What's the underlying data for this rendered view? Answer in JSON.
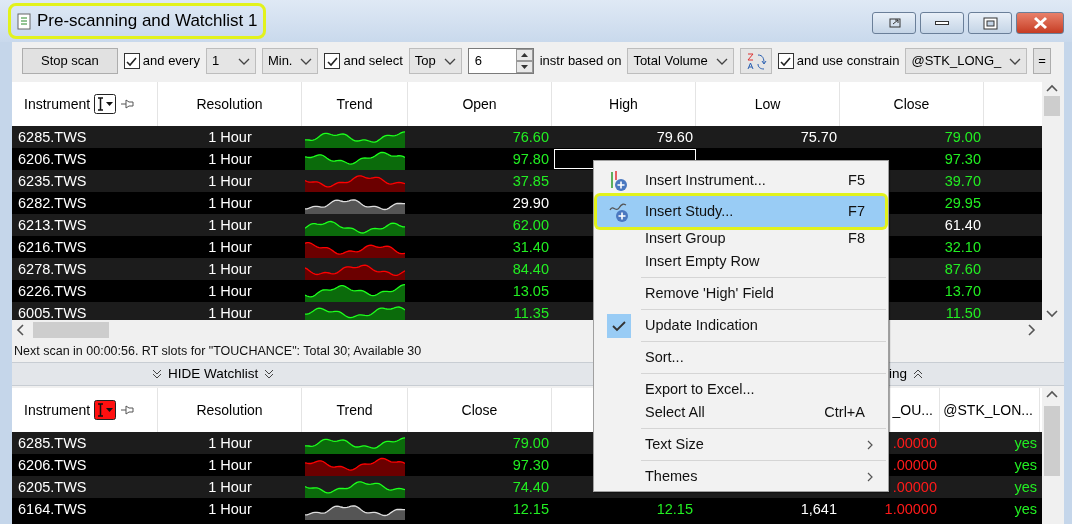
{
  "window": {
    "title": "Pre-scanning and Watchlist 1",
    "highlighted": true
  },
  "toolbar": [
    {
      "kind": "button",
      "label": "Stop scan"
    },
    {
      "kind": "checkbox",
      "label": "and every",
      "checked": true
    },
    {
      "kind": "dropdown",
      "value": "1"
    },
    {
      "kind": "dropdown",
      "value": "Min."
    },
    {
      "kind": "checkbox",
      "label": "and select",
      "checked": true
    },
    {
      "kind": "dropdown",
      "value": "Top"
    },
    {
      "kind": "spinner",
      "value": "6"
    },
    {
      "kind": "label",
      "label": "instr based on"
    },
    {
      "kind": "dropdown",
      "value": "Total Volume"
    },
    {
      "kind": "sortbutton"
    },
    {
      "kind": "checkbox",
      "label": "and use constrain",
      "checked": true
    },
    {
      "kind": "dropdown",
      "value": "@STK_LONG_"
    },
    {
      "kind": "button",
      "label": "="
    }
  ],
  "upper_table": {
    "columns": [
      "Instrument",
      "Resolution",
      "Trend",
      "Open",
      "High",
      "Low",
      "Close"
    ],
    "rows": [
      {
        "instrument": "6285.TWS",
        "resolution": "1 Hour",
        "trend": {
          "color": "#0b6b0b"
        },
        "cells": [
          {
            "text": "76.60",
            "color": "#22ee22"
          },
          {
            "text": "79.60",
            "color": "#ffffff"
          },
          {
            "text": "75.70",
            "color": "#ffffff"
          },
          {
            "text": "79.00",
            "color": "#22ee22"
          }
        ]
      },
      {
        "instrument": "6206.TWS",
        "resolution": "1 Hour",
        "trend": {
          "color": "#0b6b0b"
        },
        "cells": [
          {
            "text": "97.80",
            "color": "#22ee22"
          },
          {
            "selected": true
          },
          null,
          {
            "text": "97.30",
            "color": "#22ee22"
          }
        ]
      },
      {
        "instrument": "6235.TWS",
        "resolution": "1 Hour",
        "trend": {
          "color": "#6b0000"
        },
        "cells": [
          {
            "text": "37.85",
            "color": "#22ee22"
          },
          null,
          null,
          {
            "text": "39.70",
            "color": "#22ee22"
          }
        ]
      },
      {
        "instrument": "6282.TWS",
        "resolution": "1 Hour",
        "trend": {
          "color": "#555555"
        },
        "cells": [
          {
            "text": "29.90",
            "color": "#ffffff"
          },
          null,
          null,
          {
            "text": "29.95",
            "color": "#22ee22"
          }
        ]
      },
      {
        "instrument": "6213.TWS",
        "resolution": "1 Hour",
        "trend": {
          "color": "#0b6b0b"
        },
        "cells": [
          {
            "text": "62.00",
            "color": "#22ee22"
          },
          null,
          null,
          {
            "text": "61.40",
            "color": "#ffffff"
          }
        ]
      },
      {
        "instrument": "6216.TWS",
        "resolution": "1 Hour",
        "trend": {
          "color": "#6b0000"
        },
        "cells": [
          {
            "text": "31.40",
            "color": "#22ee22"
          },
          null,
          null,
          {
            "text": "32.10",
            "color": "#22ee22"
          }
        ]
      },
      {
        "instrument": "6278.TWS",
        "resolution": "1 Hour",
        "trend": {
          "color": "#6b0000"
        },
        "cells": [
          {
            "text": "84.40",
            "color": "#22ee22"
          },
          null,
          null,
          {
            "text": "87.60",
            "color": "#22ee22"
          }
        ]
      },
      {
        "instrument": "6226.TWS",
        "resolution": "1 Hour",
        "trend": {
          "color": "#0b6b0b"
        },
        "cells": [
          {
            "text": "13.05",
            "color": "#22ee22"
          },
          null,
          null,
          {
            "text": "13.70",
            "color": "#22ee22"
          }
        ]
      },
      {
        "instrument": "6005.TWS",
        "resolution": "1 Hour",
        "trend": {
          "color": "#0b6b0b"
        },
        "cells": [
          {
            "text": "11.35",
            "color": "#22ee22"
          },
          null,
          null,
          {
            "text": "11.50",
            "color": "#22ee22"
          }
        ]
      }
    ]
  },
  "status_text": "Next scan in 00:00:56. RT slots for \"TOUCHANCE\": Total 30; Available 30",
  "splitter": {
    "left": "HIDE Watchlist",
    "right": "ing"
  },
  "lower_table": {
    "columns": [
      "Instrument",
      "Resolution",
      "Trend",
      "Close",
      null,
      null,
      "_OU...",
      "@STK_LON..."
    ],
    "rows": [
      {
        "instrument": "6285.TWS",
        "resolution": "1 Hour",
        "trend": {
          "color": "#0b6b0b"
        },
        "cells": [
          {
            "text": "79.00",
            "color": "#22ee22"
          },
          null,
          null,
          {
            "text": ".00000",
            "color": "#ff1a1a"
          },
          {
            "text": "yes",
            "color": "#22ee22"
          }
        ]
      },
      {
        "instrument": "6206.TWS",
        "resolution": "1 Hour",
        "trend": {
          "color": "#6b0000"
        },
        "cells": [
          {
            "text": "97.30",
            "color": "#22ee22"
          },
          null,
          null,
          {
            "text": ".00000",
            "color": "#ff1a1a"
          },
          {
            "text": "yes",
            "color": "#22ee22"
          }
        ]
      },
      {
        "instrument": "6205.TWS",
        "resolution": "1 Hour",
        "trend": {
          "color": "#0b6b0b"
        },
        "cells": [
          {
            "text": "74.40",
            "color": "#22ee22"
          },
          null,
          null,
          {
            "text": ".00000",
            "color": "#ff1a1a"
          },
          {
            "text": "yes",
            "color": "#22ee22"
          }
        ]
      },
      {
        "instrument": "6164.TWS",
        "resolution": "1 Hour",
        "trend": {
          "color": "#555555"
        },
        "cells": [
          {
            "text": "12.15",
            "color": "#22ee22"
          },
          {
            "text": "12.15",
            "color": "#22ee22"
          },
          {
            "text": "1,641",
            "color": "#ffffff"
          },
          {
            "text": "1.00000",
            "color": "#ff1a1a"
          },
          {
            "text": "yes",
            "color": "#22ee22"
          }
        ]
      }
    ]
  },
  "context_menu": {
    "groups": [
      [
        {
          "label": "Insert Instrument...",
          "shortcut": "F5",
          "kind": "instrument",
          "selected": false,
          "checked": false,
          "submenu": false
        },
        {
          "label": "Insert Study...",
          "shortcut": "F7",
          "kind": "study",
          "selected": true,
          "checked": false,
          "submenu": false
        },
        {
          "label": "Insert Group",
          "shortcut": "F8",
          "kind": "plain",
          "selected": false,
          "checked": false,
          "submenu": false
        },
        {
          "label": "Insert Empty Row",
          "kind": "plain",
          "selected": false,
          "checked": false,
          "submenu": false
        }
      ],
      [
        {
          "label": "Remove 'High' Field",
          "kind": "plain",
          "selected": false,
          "checked": false,
          "submenu": false
        }
      ],
      [
        {
          "label": "Update Indication",
          "kind": "plain",
          "selected": false,
          "checked": true,
          "submenu": false
        }
      ],
      [
        {
          "label": "Sort...",
          "kind": "plain",
          "selected": false,
          "checked": false,
          "submenu": false
        }
      ],
      [
        {
          "label": "Export to Excel...",
          "kind": "plain",
          "selected": false,
          "checked": false,
          "submenu": false
        },
        {
          "label": "Select All",
          "shortcut": "Ctrl+A",
          "kind": "plain",
          "selected": false,
          "checked": false,
          "submenu": false
        }
      ],
      [
        {
          "label": "Text Size",
          "kind": "plain",
          "selected": false,
          "checked": false,
          "submenu": true
        }
      ],
      [
        {
          "label": "Themes",
          "kind": "plain",
          "selected": false,
          "checked": false,
          "submenu": true
        }
      ]
    ]
  }
}
